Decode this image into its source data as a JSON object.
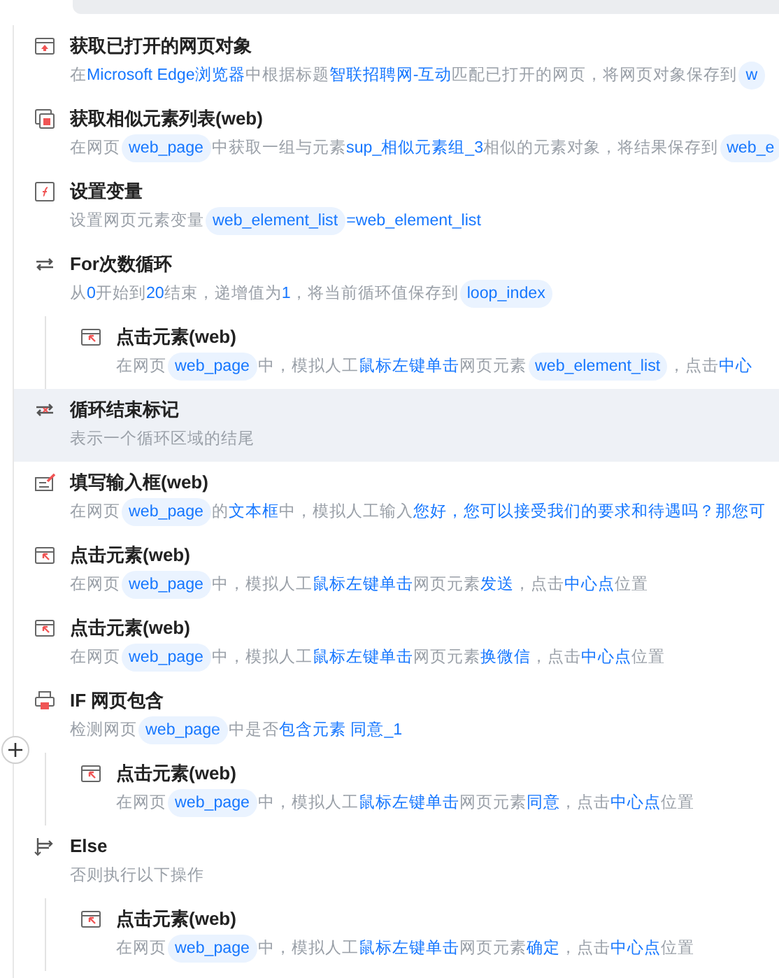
{
  "steps": [
    {
      "kind": "browser",
      "selected": false,
      "title": "获取已打开的网页对象",
      "description": [
        {
          "kind": "text",
          "text": "在"
        },
        {
          "kind": "link",
          "text": "Microsoft Edge浏览器"
        },
        {
          "kind": "text",
          "text": "中根据标题"
        },
        {
          "kind": "link",
          "text": "智联招聘网-互动"
        },
        {
          "kind": "text",
          "text": "匹配已打开的网页，将网页对象保存到"
        },
        {
          "kind": "chip",
          "text": "w"
        }
      ]
    },
    {
      "kind": "similar",
      "selected": false,
      "title": "获取相似元素列表(web)",
      "description": [
        {
          "kind": "text",
          "text": "在网页"
        },
        {
          "kind": "chip",
          "text": "web_page"
        },
        {
          "kind": "text",
          "text": "中获取一组与元素"
        },
        {
          "kind": "link",
          "text": "sup_相似元素组_3"
        },
        {
          "kind": "text",
          "text": "相似的元素对象，将结果保存到"
        },
        {
          "kind": "chip",
          "text": "web_e"
        }
      ]
    },
    {
      "kind": "variable",
      "selected": false,
      "title": "设置变量",
      "description": [
        {
          "kind": "text",
          "text": "设置网页元素变量"
        },
        {
          "kind": "chip",
          "text": "web_element_list"
        },
        {
          "kind": "link",
          "text": "=web_element_list"
        }
      ]
    },
    {
      "kind": "loop",
      "selected": false,
      "title": "For次数循环",
      "description": [
        {
          "kind": "text",
          "text": "从"
        },
        {
          "kind": "link",
          "text": "0"
        },
        {
          "kind": "text",
          "text": "开始到"
        },
        {
          "kind": "link",
          "text": "20"
        },
        {
          "kind": "text",
          "text": "结束，递增值为"
        },
        {
          "kind": "link",
          "text": "1"
        },
        {
          "kind": "text",
          "text": "，将当前循环值保存到"
        },
        {
          "kind": "chip",
          "text": "loop_index"
        }
      ],
      "children": [
        {
          "kind": "click",
          "selected": false,
          "title": "点击元素(web)",
          "description": [
            {
              "kind": "text",
              "text": "在网页"
            },
            {
              "kind": "chip",
              "text": "web_page"
            },
            {
              "kind": "text",
              "text": "中，模拟人工"
            },
            {
              "kind": "link",
              "text": "鼠标左键单击"
            },
            {
              "kind": "text",
              "text": "网页元素"
            },
            {
              "kind": "chip",
              "text": "web_element_list"
            },
            {
              "kind": "text",
              "text": "，点击"
            },
            {
              "kind": "link",
              "text": "中心"
            }
          ]
        }
      ]
    },
    {
      "kind": "loop_end",
      "selected": true,
      "title": "循环结束标记",
      "description": [
        {
          "kind": "text",
          "text": "表示一个循环区域的结尾"
        }
      ]
    },
    {
      "kind": "input",
      "selected": false,
      "title": "填写输入框(web)",
      "description": [
        {
          "kind": "text",
          "text": "在网页"
        },
        {
          "kind": "chip",
          "text": "web_page"
        },
        {
          "kind": "text",
          "text": "的"
        },
        {
          "kind": "link",
          "text": "文本框"
        },
        {
          "kind": "text",
          "text": "中，模拟人工输入"
        },
        {
          "kind": "link",
          "text": "您好，您可以接受我们的要求和待遇吗？那您可"
        }
      ]
    },
    {
      "kind": "click",
      "selected": false,
      "title": "点击元素(web)",
      "description": [
        {
          "kind": "text",
          "text": "在网页"
        },
        {
          "kind": "chip",
          "text": "web_page"
        },
        {
          "kind": "text",
          "text": "中，模拟人工"
        },
        {
          "kind": "link",
          "text": "鼠标左键单击"
        },
        {
          "kind": "text",
          "text": "网页元素"
        },
        {
          "kind": "link",
          "text": "发送"
        },
        {
          "kind": "text",
          "text": "，点击"
        },
        {
          "kind": "link",
          "text": "中心点"
        },
        {
          "kind": "text",
          "text": "位置"
        }
      ]
    },
    {
      "kind": "click",
      "selected": false,
      "title": "点击元素(web)",
      "description": [
        {
          "kind": "text",
          "text": "在网页"
        },
        {
          "kind": "chip",
          "text": "web_page"
        },
        {
          "kind": "text",
          "text": "中，模拟人工"
        },
        {
          "kind": "link",
          "text": "鼠标左键单击"
        },
        {
          "kind": "text",
          "text": "网页元素"
        },
        {
          "kind": "link",
          "text": "换微信"
        },
        {
          "kind": "text",
          "text": "，点击"
        },
        {
          "kind": "link",
          "text": "中心点"
        },
        {
          "kind": "text",
          "text": "位置"
        }
      ]
    },
    {
      "kind": "if",
      "selected": false,
      "title": "IF 网页包含",
      "description": [
        {
          "kind": "text",
          "text": "检测网页"
        },
        {
          "kind": "chip",
          "text": "web_page"
        },
        {
          "kind": "text",
          "text": "中是否"
        },
        {
          "kind": "link",
          "text": "包含元素 同意_1"
        }
      ],
      "children": [
        {
          "kind": "click",
          "selected": false,
          "title": "点击元素(web)",
          "description": [
            {
              "kind": "text",
              "text": "在网页"
            },
            {
              "kind": "chip",
              "text": "web_page"
            },
            {
              "kind": "text",
              "text": "中，模拟人工"
            },
            {
              "kind": "link",
              "text": "鼠标左键单击"
            },
            {
              "kind": "text",
              "text": "网页元素"
            },
            {
              "kind": "link",
              "text": "同意"
            },
            {
              "kind": "text",
              "text": "，点击"
            },
            {
              "kind": "link",
              "text": "中心点"
            },
            {
              "kind": "text",
              "text": "位置"
            }
          ]
        }
      ]
    },
    {
      "kind": "else",
      "selected": false,
      "title": "Else",
      "description": [
        {
          "kind": "text",
          "text": "否则执行以下操作"
        }
      ],
      "children": [
        {
          "kind": "click",
          "selected": false,
          "title": "点击元素(web)",
          "description": [
            {
              "kind": "text",
              "text": "在网页"
            },
            {
              "kind": "chip",
              "text": "web_page"
            },
            {
              "kind": "text",
              "text": "中，模拟人工"
            },
            {
              "kind": "link",
              "text": "鼠标左键单击"
            },
            {
              "kind": "text",
              "text": "网页元素"
            },
            {
              "kind": "link",
              "text": "确定"
            },
            {
              "kind": "text",
              "text": "，点击"
            },
            {
              "kind": "link",
              "text": "中心点"
            },
            {
              "kind": "text",
              "text": "位置"
            }
          ]
        }
      ]
    }
  ]
}
